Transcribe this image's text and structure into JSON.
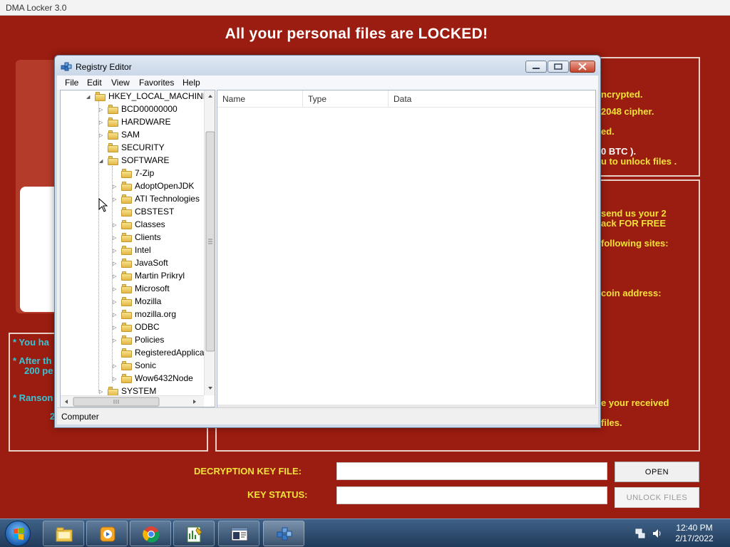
{
  "dma_window": {
    "title": "DMA Locker 3.0",
    "headline": "All your personal files are LOCKED!",
    "info_lines": [
      "ncrypted.",
      "2048 cipher.",
      "ed.",
      "0 BTC ).",
      "u to unlock files .",
      "send us your 2",
      "ack FOR FREE",
      " following sites:",
      "coin address:",
      "e your received",
      "files."
    ],
    "notes": [
      "* You ha",
      "* After th",
      "200 pe",
      "* Ranson",
      "2"
    ],
    "decryption_key_label": "DECRYPTION KEY FILE:",
    "decryption_key_value": "",
    "key_status_label": "KEY STATUS:",
    "key_status_value": "",
    "open_button": "OPEN",
    "unlock_button": "UNLOCK FILES"
  },
  "regedit": {
    "title": "Registry Editor",
    "menu": [
      "File",
      "Edit",
      "View",
      "Favorites",
      "Help"
    ],
    "tree": {
      "root": "HKEY_LOCAL_MACHINE",
      "hive_children": [
        "BCD00000000",
        "HARDWARE",
        "SAM",
        "SECURITY",
        "SOFTWARE"
      ],
      "software_children": [
        "7-Zip",
        "AdoptOpenJDK",
        "ATI Technologies",
        "CBSTEST",
        "Classes",
        "Clients",
        "Intel",
        "JavaSoft",
        "Martin Prikryl",
        "Microsoft",
        "Mozilla",
        "mozilla.org",
        "ODBC",
        "Policies",
        "RegisteredApplica",
        "Sonic",
        "Wow6432Node"
      ],
      "after": "SYSTEM"
    },
    "columns": [
      "Name",
      "Type",
      "Data"
    ],
    "status": "Computer"
  },
  "taskbar": {
    "apps": [
      "explorer-icon",
      "media-player-icon",
      "chrome-icon",
      "notepad-chart-icon",
      "console-icon",
      "registry-editor-icon"
    ],
    "time": "12:40 PM",
    "date": "2/17/2022"
  }
}
